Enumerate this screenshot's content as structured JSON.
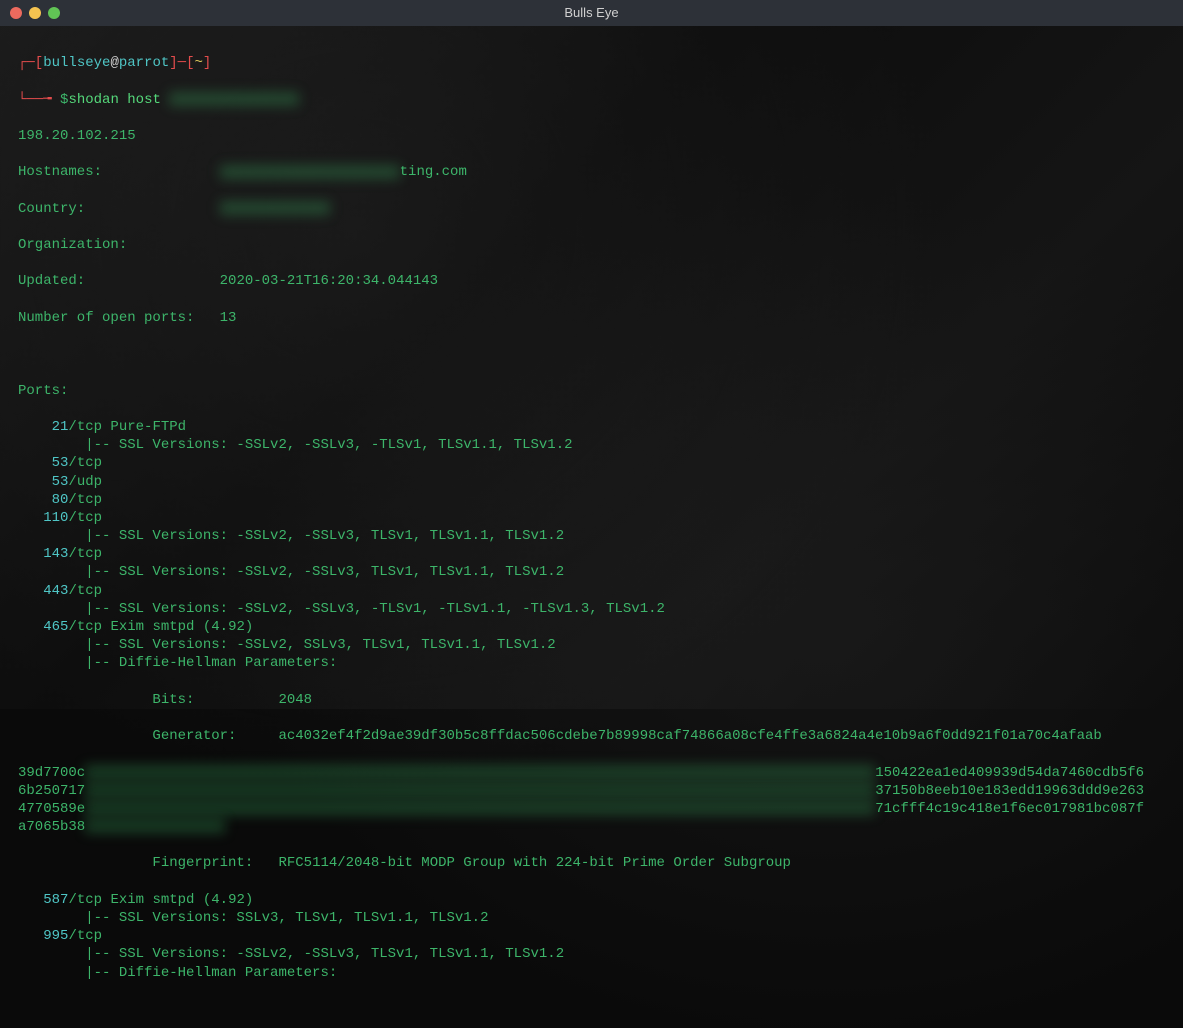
{
  "window": {
    "title": "Bulls Eye"
  },
  "prompt": {
    "bracket_l": "┌─[",
    "user": "bullseye",
    "at": "@",
    "host": "parrot",
    "bracket_r": "]─[",
    "tilde": "~",
    "bracket_close": "]",
    "line2_pre": "└──╼ ",
    "dollar": "$",
    "command": "shodan host "
  },
  "output": {
    "ip": "198.20.102.215",
    "hostnames_label": "Hostnames:",
    "hostnames_suffix": "ting.com",
    "country_label": "Country:",
    "org_label": "Organization:",
    "updated_label": "Updated:",
    "updated_value": "2020-03-21T16:20:34.044143",
    "ports_count_label": "Number of open ports:",
    "ports_count_value": "13",
    "ports_header": "Ports:",
    "ports": [
      {
        "port": "21",
        "proto": "/tcp",
        "service": " Pure-FTPd",
        "sub": [
          "|-- SSL Versions: -SSLv2, -SSLv3, -TLSv1, TLSv1.1, TLSv1.2"
        ]
      },
      {
        "port": "53",
        "proto": "/tcp",
        "service": "",
        "sub": []
      },
      {
        "port": "53",
        "proto": "/udp",
        "service": "",
        "sub": []
      },
      {
        "port": "80",
        "proto": "/tcp",
        "service": "",
        "sub": []
      },
      {
        "port": "110",
        "proto": "/tcp",
        "service": "",
        "sub": [
          "|-- SSL Versions: -SSLv2, -SSLv3, TLSv1, TLSv1.1, TLSv1.2"
        ]
      },
      {
        "port": "143",
        "proto": "/tcp",
        "service": "",
        "sub": [
          "|-- SSL Versions: -SSLv2, -SSLv3, TLSv1, TLSv1.1, TLSv1.2"
        ]
      },
      {
        "port": "443",
        "proto": "/tcp",
        "service": "",
        "sub": [
          "|-- SSL Versions: -SSLv2, -SSLv3, -TLSv1, -TLSv1.1, -TLSv1.3, TLSv1.2"
        ]
      },
      {
        "port": "465",
        "proto": "/tcp",
        "service": " Exim smtpd (4.92)",
        "sub": [
          "|-- SSL Versions: -SSLv2, SSLv3, TLSv1, TLSv1.1, TLSv1.2",
          "|-- Diffie-Hellman Parameters:"
        ]
      }
    ],
    "dh": {
      "bits_label": "Bits:",
      "bits_value": "2048",
      "gen_label": "Generator:",
      "gen_value": "ac4032ef4f2d9ae39df30b5c8ffdac506cdebe7b89998caf74866a08cfe4ffe3a6824a4e10b9a6f0dd921f01a70c4afaab",
      "hex_left": [
        "39d7700c",
        "6b250717",
        "4770589e",
        "a7065b38"
      ],
      "hex_right": [
        "150422ea1ed409939d54da7460cdb5f6",
        "37150b8eeb10e183edd19963ddd9e263",
        "71cfff4c19c418e1f6ec017981bc087f"
      ],
      "fingerprint_label": "Fingerprint:",
      "fingerprint_value": "RFC5114/2048-bit MODP Group with 224-bit Prime Order Subgroup"
    },
    "ports_after": [
      {
        "port": "587",
        "proto": "/tcp",
        "service": " Exim smtpd (4.92)",
        "sub": [
          "|-- SSL Versions: SSLv3, TLSv1, TLSv1.1, TLSv1.2"
        ]
      },
      {
        "port": "995",
        "proto": "/tcp",
        "service": "",
        "sub": [
          "|-- SSL Versions: -SSLv2, -SSLv3, TLSv1, TLSv1.1, TLSv1.2",
          "|-- Diffie-Hellman Parameters:"
        ]
      }
    ]
  }
}
